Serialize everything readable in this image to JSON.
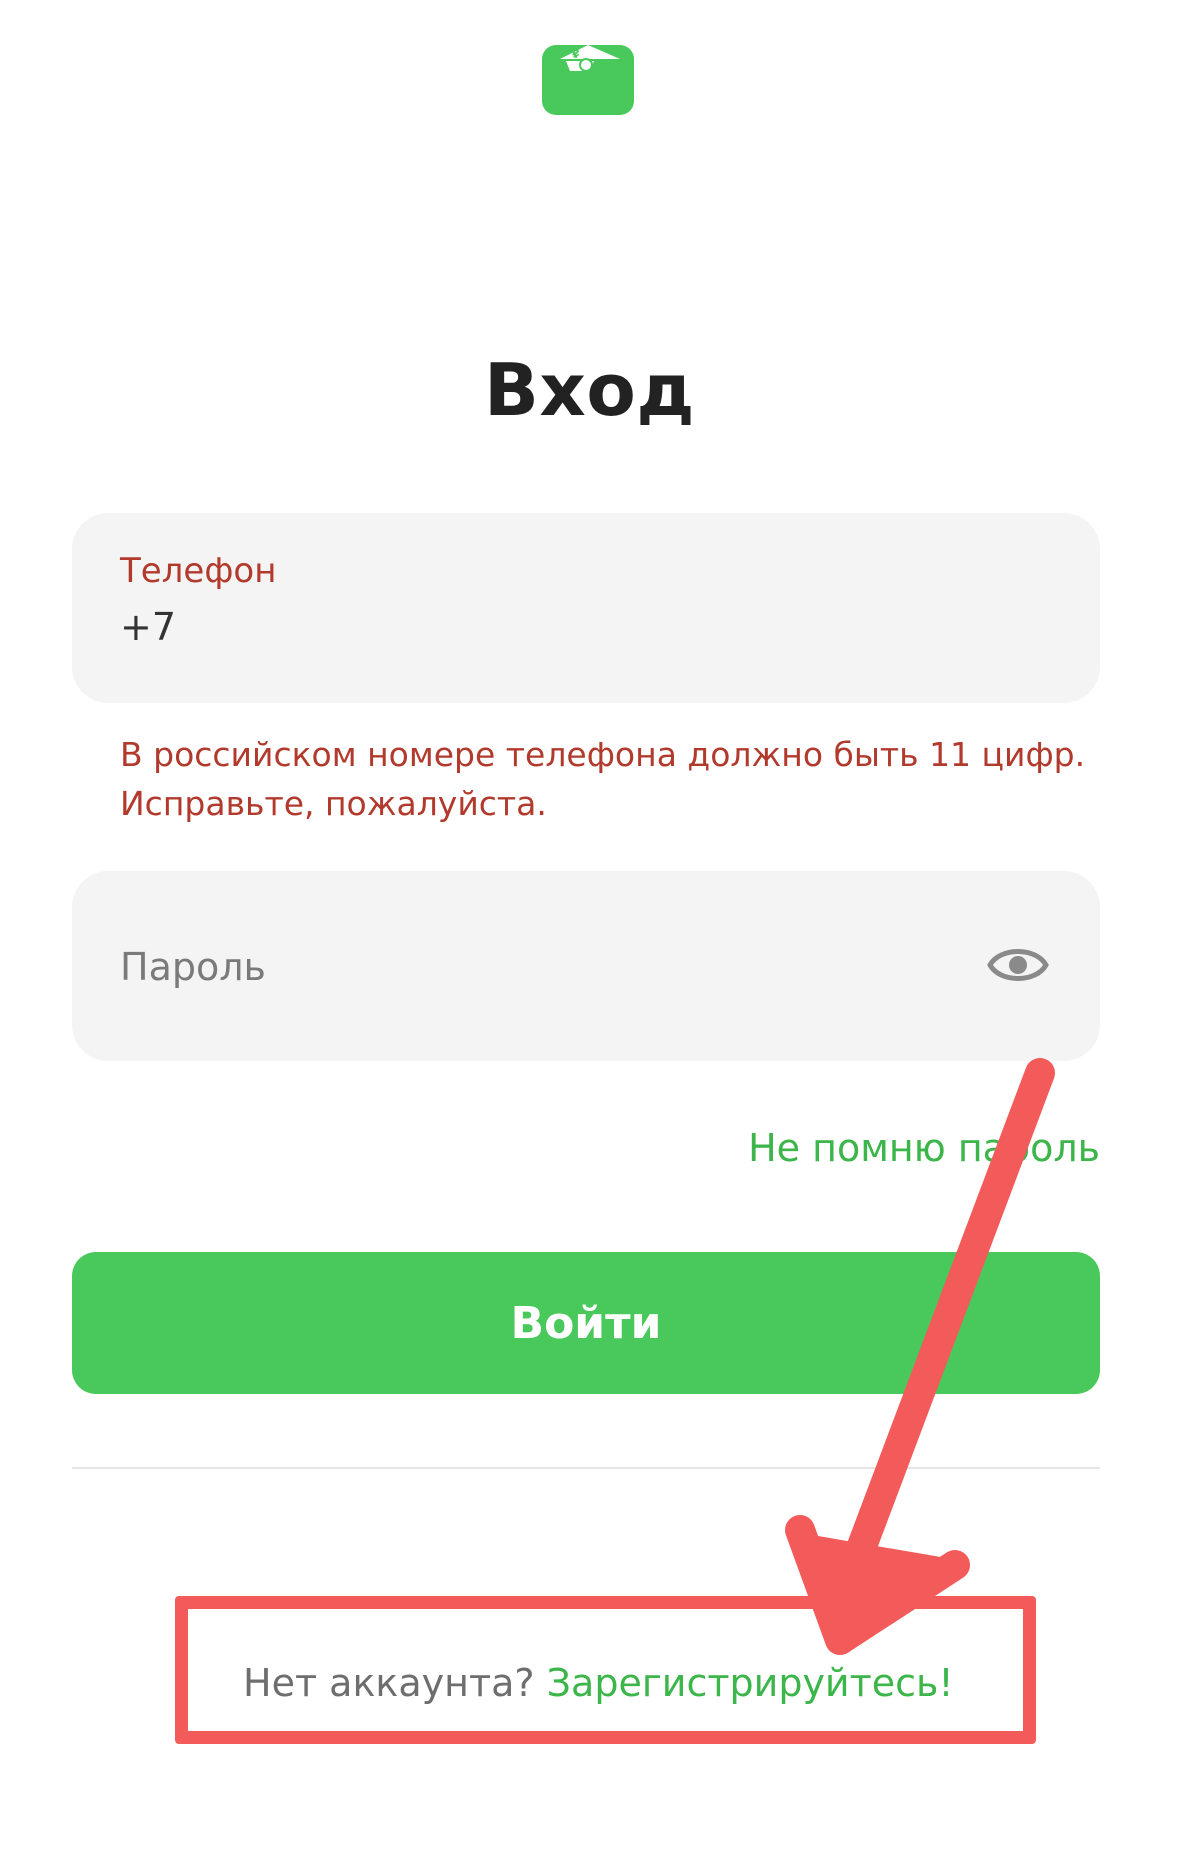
{
  "colors": {
    "brand_green": "#49c95b",
    "link_green": "#3cb54a",
    "error_red": "#b23a2d",
    "annotation_red": "#f35a5a",
    "field_bg": "#f4f4f4"
  },
  "header": {
    "logo_icon": "wallet-logo-icon"
  },
  "page_title": "Вход",
  "phone_field": {
    "label": "Телефон",
    "value": "+7"
  },
  "phone_error": {
    "line1": "В российском номере телефона должно быть 11 цифр.",
    "line2": "Исправьте, пожалуйста."
  },
  "password_field": {
    "placeholder": "Пароль",
    "toggle_icon": "eye-icon"
  },
  "forgot_password_link": "Не помню пароль",
  "login_button": "Войти",
  "register": {
    "question": "Нет аккаунта?",
    "link": "Зарегистрируйтесь!"
  },
  "annotation": {
    "arrow_icon": "arrow-annotation-icon"
  }
}
